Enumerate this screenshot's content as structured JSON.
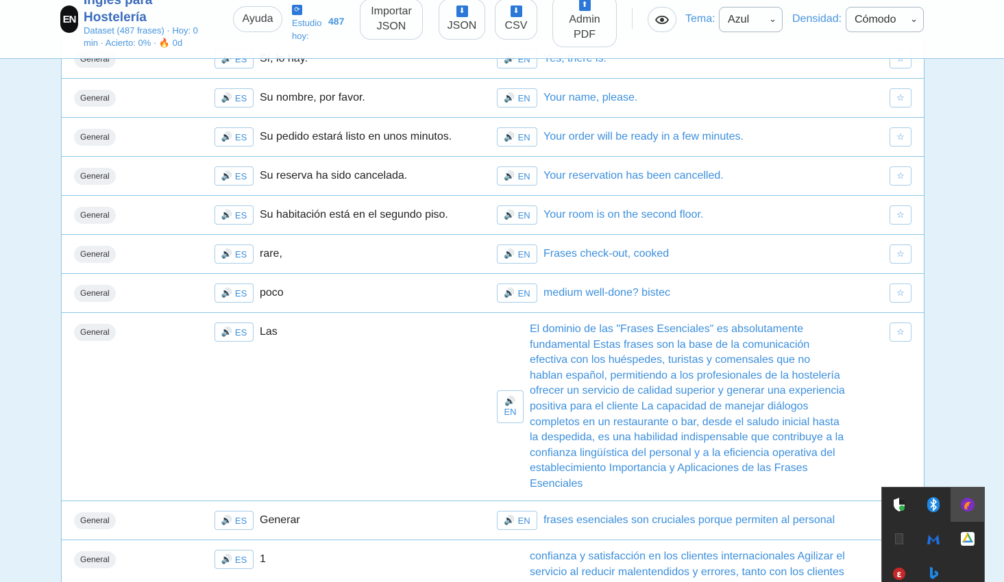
{
  "header": {
    "logo": "EN",
    "title": "Inglés para Hostelería",
    "subtitle": "Dataset (487 frases) · Hoy: 0 min · Acierto: 0% · 🔥 0d",
    "help_label": "Ayuda",
    "study_label": "Estudio hoy:",
    "study_count": "487",
    "import_label": "Importar JSON",
    "json_label": "JSON",
    "csv_label": "CSV",
    "admin_label": "Admin PDF",
    "theme_label": "Tema:",
    "theme_value": "Azul",
    "density_label": "Densidad:",
    "density_value": "Cómodo"
  },
  "audio": {
    "es": "ES",
    "en": "EN",
    "star": "☆"
  },
  "rows": [
    {
      "tag": "General",
      "es": "Sí, lo hay.",
      "en": "Yes, there is."
    },
    {
      "tag": "General",
      "es": "Su nombre, por favor.",
      "en": "Your name, please."
    },
    {
      "tag": "General",
      "es": "Su pedido estará listo en unos minutos.",
      "en": "Your order will be ready in a few minutes."
    },
    {
      "tag": "General",
      "es": "Su reserva ha sido cancelada.",
      "en": "Your reservation has been cancelled."
    },
    {
      "tag": "General",
      "es": "Su habitación está en el segundo piso.",
      "en": "Your room is on the second floor."
    },
    {
      "tag": "General",
      "es": "rare,",
      "en": "Frases check-out, cooked"
    },
    {
      "tag": "General",
      "es": "poco",
      "en": "medium well-done? bistec"
    },
    {
      "tag": "General",
      "es": "Las",
      "en": "El dominio de las \"Frases Esenciales\" es absolutamente fundamental Estas frases son la base de la comunicación efectiva con los huéspedes, turistas y comensales que no hablan español, permitiendo a los profesionales de la hostelería ofrecer un servicio de calidad superior y generar una experiencia positiva para el cliente La capacidad de manejar diálogos completos en un restaurante o bar, desde el saludo inicial hasta la despedida, es una habilidad indispensable que contribuye a la confianza lingüística del personal y a la eficiencia operativa del establecimiento Importancia y Aplicaciones de las Frases Esenciales"
    },
    {
      "tag": "General",
      "es": "Generar",
      "en": "frases esenciales son cruciales porque permiten al personal"
    },
    {
      "tag": "General",
      "es": "1",
      "en": "confianza y satisfacción en los clientes internacionales Agilizar el servicio al reducir malentendidos y errores, tanto con los clientes"
    }
  ],
  "tray": {
    "icons": [
      "shield-icon",
      "bluetooth-icon",
      "firefox-icon",
      "blank-icon",
      "malwarebytes-icon",
      "google-drive-icon",
      "app-red-icon",
      "bing-icon"
    ]
  }
}
